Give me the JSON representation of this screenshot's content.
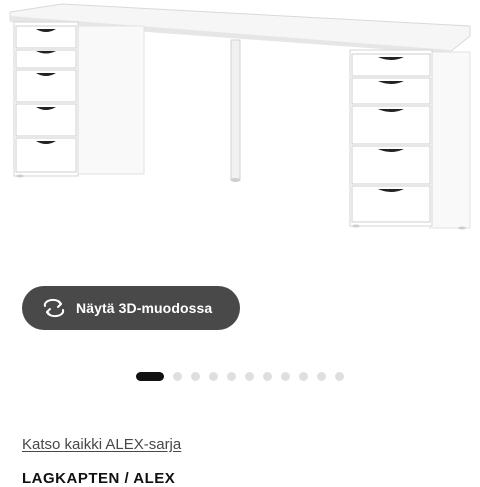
{
  "product_image": {
    "alt": "LAGKAPTEN / ALEX"
  },
  "view_3d_button": {
    "label": "Näytä 3D-muodossa",
    "icon": "rotate-3d-icon"
  },
  "carousel": {
    "total": 11,
    "active_index": 0
  },
  "series_link": {
    "label": "Katso kaikki ALEX-sarja"
  },
  "product": {
    "name": "LAGKAPTEN / ALEX"
  },
  "colors": {
    "button_bg": "#494949",
    "dot_active": "#111111",
    "dot_inactive": "#dfdfdf"
  }
}
